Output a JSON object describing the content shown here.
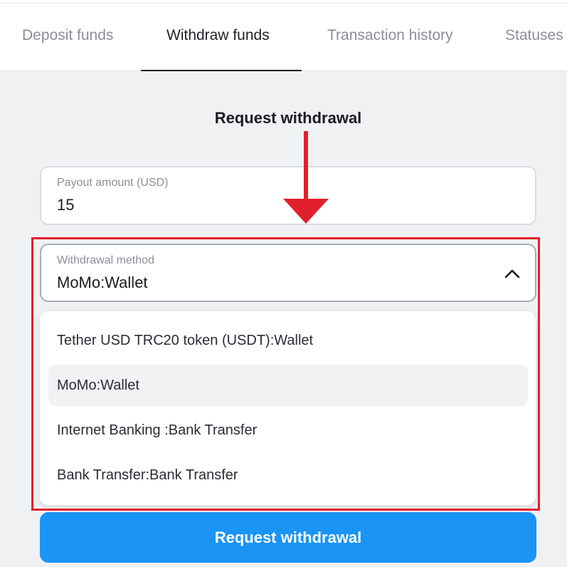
{
  "tabs": [
    {
      "label": "Deposit funds",
      "active": false
    },
    {
      "label": "Withdraw funds",
      "active": true
    },
    {
      "label": "Transaction history",
      "active": false
    },
    {
      "label": "Statuses",
      "active": false
    }
  ],
  "heading": "Request withdrawal",
  "payout": {
    "label": "Payout amount (USD)",
    "value": "15"
  },
  "withdrawal_method": {
    "label": "Withdrawal method",
    "value": "MoMo:Wallet",
    "expanded": true,
    "toggle_icon": "chevron-up-icon",
    "options": [
      {
        "label": "Tether USD TRC20 token (USDT):Wallet",
        "selected": false
      },
      {
        "label": "MoMo:Wallet",
        "selected": true
      },
      {
        "label": "Internet Banking :Bank Transfer",
        "selected": false
      },
      {
        "label": "Bank Transfer:Bank Transfer",
        "selected": false
      }
    ]
  },
  "submit_label": "Request withdrawal",
  "annotation": {
    "icon": "down-arrow-icon",
    "color": "#e2202c"
  },
  "colors": {
    "accent": "#1a94f5",
    "annotation": "#e2202c"
  }
}
